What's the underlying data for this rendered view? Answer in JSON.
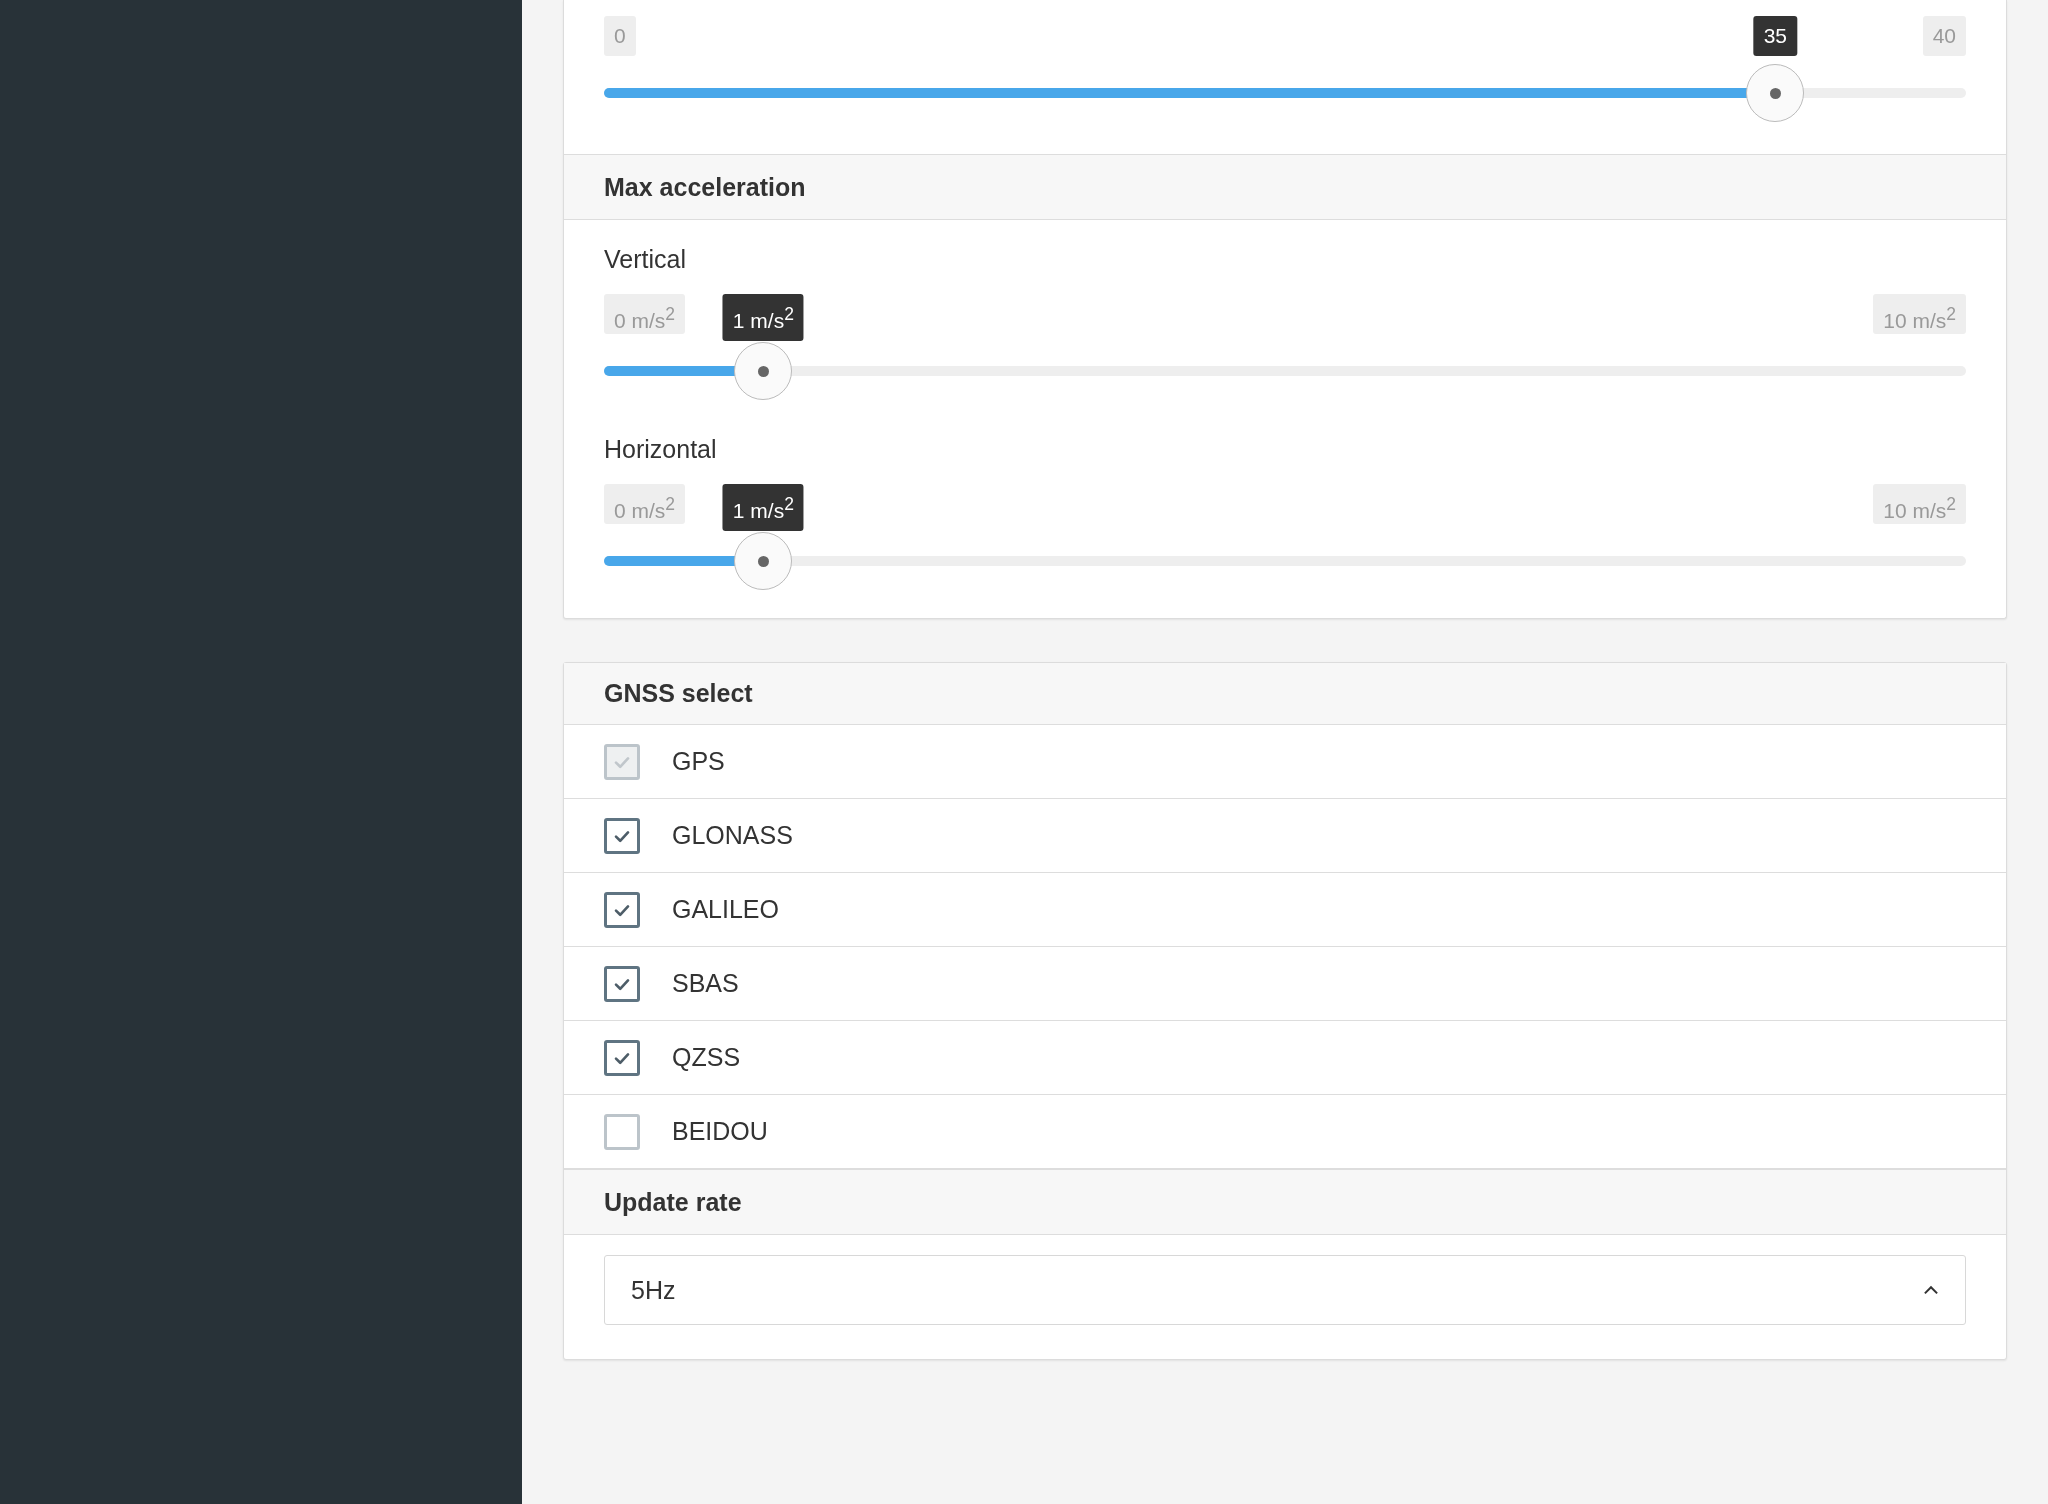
{
  "top_slider": {
    "min": "0",
    "value": "35",
    "max": "40",
    "level": 0.86
  },
  "max_acceleration": {
    "title": "Max acceleration",
    "sliders": [
      {
        "label": "Vertical",
        "min": "0 m/s$^{2}$",
        "value": "1 m/s$^{2}$",
        "max": "10 m/s$^{2}$",
        "level": 0.117
      },
      {
        "label": "Horizontal",
        "min": "0 m/s$^{2}$",
        "value": "1 m/s$^{2}$",
        "max": "10 m/s$^{2}$",
        "level": 0.117
      }
    ]
  },
  "gnss_select": {
    "title": "GNSS select",
    "options": [
      {
        "label": "GPS",
        "checked": true,
        "disabled": true
      },
      {
        "label": "GLONASS",
        "checked": true,
        "disabled": false
      },
      {
        "label": "GALILEO",
        "checked": true,
        "disabled": false
      },
      {
        "label": "SBAS",
        "checked": true,
        "disabled": false
      },
      {
        "label": "QZSS",
        "checked": true,
        "disabled": false
      },
      {
        "label": "BEIDOU",
        "checked": false,
        "disabled": false
      }
    ]
  },
  "update_rate": {
    "title": "Update rate",
    "value": "5Hz"
  }
}
